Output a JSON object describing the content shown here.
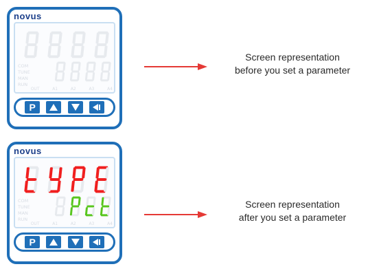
{
  "brand": "novus",
  "colors": {
    "panel_border": "#1f6fb8",
    "arrow": "#e53935",
    "display_red": "#f01f1f",
    "display_green": "#58c61e",
    "display_off": "#e7eaee"
  },
  "indicators": {
    "side": [
      "COM",
      "TUNE",
      "MAN",
      "RUN"
    ],
    "bottom": [
      "OUT",
      "A1",
      "A2",
      "A3",
      "A4"
    ]
  },
  "keys": [
    {
      "label": "P",
      "icon": "p-key"
    },
    {
      "label": "",
      "icon": "up-triangle-icon"
    },
    {
      "label": "",
      "icon": "down-triangle-icon"
    },
    {
      "label": "",
      "icon": "back-arrow-icon"
    }
  ],
  "panels": [
    {
      "caption": [
        "Screen representation",
        "before you set a parameter"
      ],
      "top_display": "8888",
      "bottom_display": "8888",
      "lit": false
    },
    {
      "caption": [
        "Screen representation",
        "after you set a parameter"
      ],
      "top_display": "tYPE",
      "bottom_display": "Pct",
      "lit": true
    }
  ]
}
